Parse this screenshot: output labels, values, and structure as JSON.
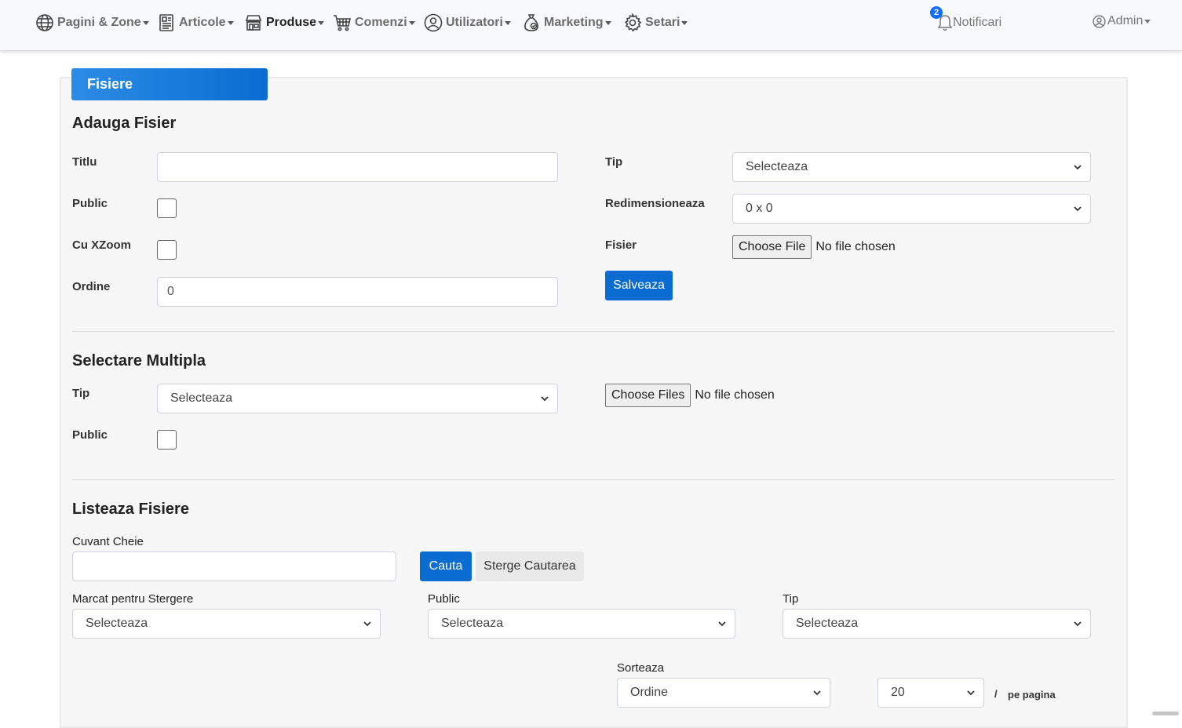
{
  "nav": {
    "items": [
      {
        "label": "Pagini & Zone",
        "icon": "globe-icon"
      },
      {
        "label": "Articole",
        "icon": "newspaper-icon"
      },
      {
        "label": "Produse",
        "icon": "shop-icon"
      },
      {
        "label": "Comenzi",
        "icon": "cart-icon"
      },
      {
        "label": "Utilizatori",
        "icon": "user-circle-icon"
      },
      {
        "label": "Marketing",
        "icon": "money-bag-icon"
      },
      {
        "label": "Setari",
        "icon": "gear-icon"
      }
    ],
    "notifications": {
      "label": "Notificari",
      "count": "2"
    },
    "user": {
      "label": "Admin"
    }
  },
  "card": {
    "tab": "Fisiere"
  },
  "add_file": {
    "title": "Adauga Fisier",
    "titlu_label": "Titlu",
    "titlu_value": "",
    "public_label": "Public",
    "xzoom_label": "Cu XZoom",
    "ordine_label": "Ordine",
    "ordine_value": "0",
    "tip_label": "Tip",
    "tip_value": "Selecteaza",
    "resize_label": "Redimensioneaza",
    "resize_value": "0 x 0",
    "file_label": "Fisier",
    "choose_file": "Choose File",
    "no_file": "No file chosen",
    "save": "Salveaza"
  },
  "multi": {
    "title": "Selectare Multipla",
    "tip_label": "Tip",
    "tip_value": "Selecteaza",
    "public_label": "Public",
    "choose_files": "Choose Files",
    "no_file": "No file chosen"
  },
  "list": {
    "title": "Listeaza Fisiere",
    "keyword_label": "Cuvant Cheie",
    "keyword_value": "",
    "search": "Cauta",
    "clear": "Sterge Cautarea",
    "marked_label": "Marcat pentru Stergere",
    "marked_value": "Selecteaza",
    "public_label": "Public",
    "public_value": "Selecteaza",
    "tip_label": "Tip",
    "tip_value": "Selecteaza",
    "sort_label": "Sorteaza",
    "sort_value": "Ordine",
    "per_page_value": "20",
    "slash": "/",
    "per_page_label": "pe pagina"
  }
}
